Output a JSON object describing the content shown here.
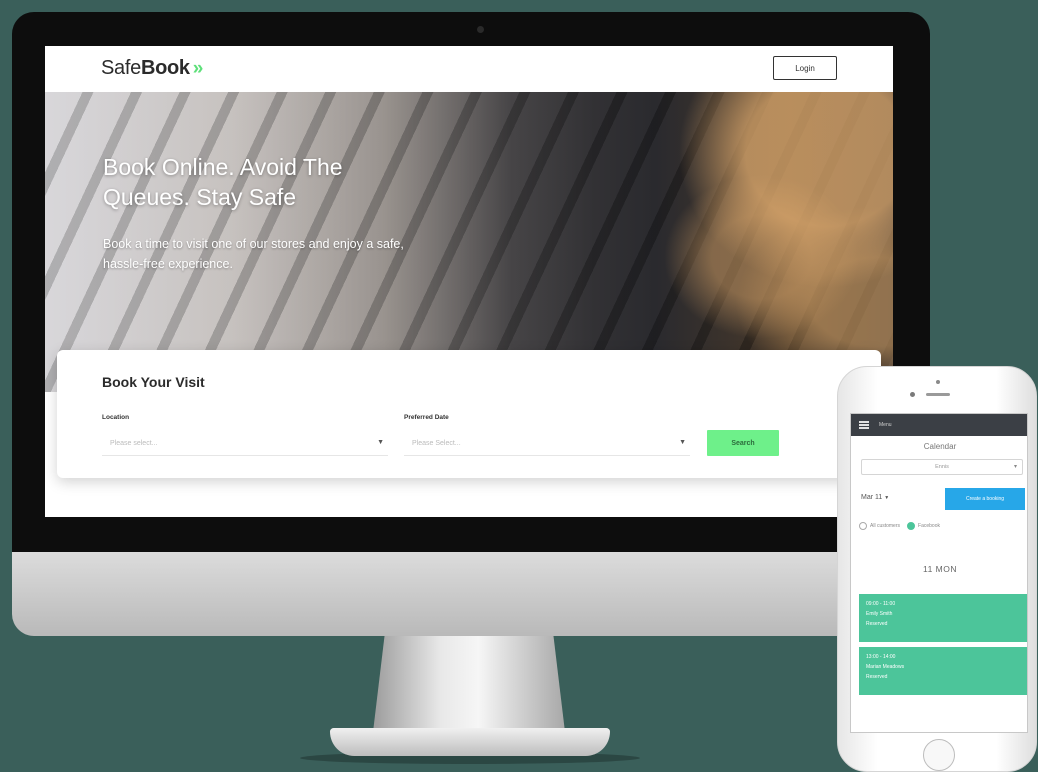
{
  "site": {
    "logo_light": "Safe",
    "logo_bold": "Book",
    "logo_chevrons": "»",
    "login_label": "Login",
    "hero_title": "Book Online. Avoid The Queues. Stay Safe",
    "hero_subtitle": "Book a time to visit one of our stores and enjoy a safe, hassle-free experience.",
    "booking_title": "Book Your Visit",
    "location_label": "Location",
    "location_placeholder": "Please select...",
    "date_label": "Preferred Date",
    "date_placeholder": "Please Select...",
    "search_label": "Search",
    "accent_color": "#6ef08a"
  },
  "phone": {
    "app_bar_label": "Menu",
    "calendar_title": "Calendar",
    "store_select_value": "Ennis",
    "date_text": "Mar 11",
    "create_button_label": "Create a booking",
    "radio_options": [
      "All customers",
      "Facebook"
    ],
    "radio_selected": "Facebook",
    "day_title": "11 MON",
    "slots": [
      {
        "time": "09:00 - 11:00",
        "name": "Emily Smith",
        "status": "Reserved"
      },
      {
        "time": "13:00 - 14:00",
        "name": "Marian Meadows",
        "status": "Reserved"
      }
    ],
    "slot_color": "#4cc59a",
    "button_color": "#27a7e8"
  }
}
